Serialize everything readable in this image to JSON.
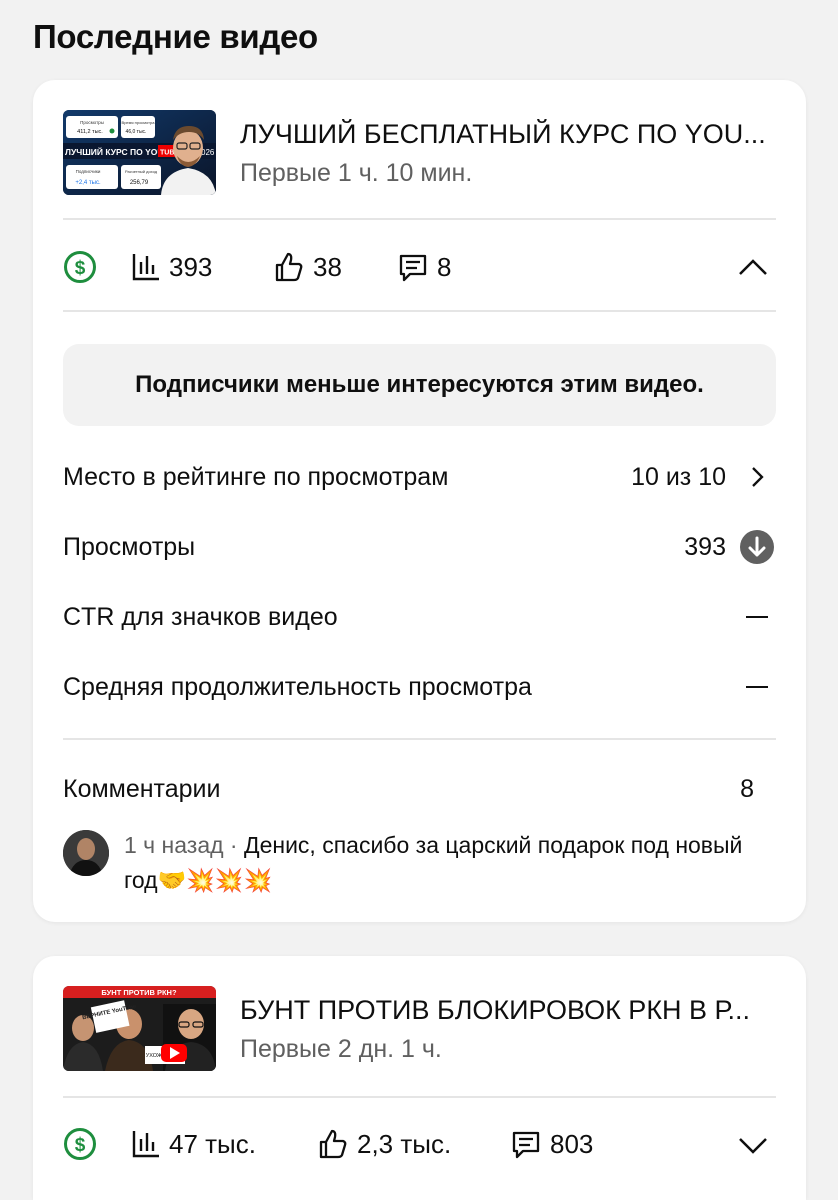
{
  "section_title": "Последние видео",
  "videos": [
    {
      "title": "ЛУЧШИЙ БЕСПЛАТНЫЙ КУРС ПО YOU...",
      "meta": "Первые 1 ч. 10 мин.",
      "thumb_text": {
        "views_label": "Просмотры",
        "views_value": "411,2 тыс.",
        "watch_label": "Время просмотра",
        "watch_value": "46,0 тыс.",
        "banner_left": "ЛУЧШИЙ КУРС ПО YOU",
        "banner_right": "TUBE",
        "year": "026",
        "subs_label": "Подписчики",
        "subs_value": "+2,4 тыс.",
        "revenue_label": "Расчетный доход",
        "revenue_value": "256,79"
      },
      "stats": {
        "views": "393",
        "likes": "38",
        "comments": "8"
      },
      "expanded": true,
      "notice": "Подписчики меньше интересуются этим видео.",
      "metrics": [
        {
          "label": "Место в рейтинге по просмотрам",
          "value": "10 из 10"
        },
        {
          "label": "Просмотры",
          "value": "393"
        },
        {
          "label": "CTR для значков видео",
          "value": ""
        },
        {
          "label": "Средняя продолжительность просмотра",
          "value": ""
        }
      ],
      "comments_label": "Комментарии",
      "comments_count": "8",
      "latest_comment": {
        "time": "1 ч назад",
        "separator": " · ",
        "text": "Денис, спасибо за царский подарок под новый год",
        "emojis": "🤝💥💥💥"
      }
    },
    {
      "title": "БУНТ ПРОТИВ БЛОКИРОВОК РКН В Р...",
      "meta": "Первые 2 дн. 1 ч.",
      "thumb_text": {
        "banner": "БУНТ ПРОТИВ РКН?",
        "sign": "ВЕРНИТЕ YouTube",
        "sign2": "УХОЖУ В MAX"
      },
      "stats": {
        "views": "47 тыс.",
        "likes": "2,3 тыс.",
        "comments": "803"
      },
      "expanded": false
    }
  ],
  "colors": {
    "monetization_green": "#1e8e3e",
    "text": "#0f0f0f",
    "secondary": "#606060",
    "youtube_red": "#ff0000"
  }
}
